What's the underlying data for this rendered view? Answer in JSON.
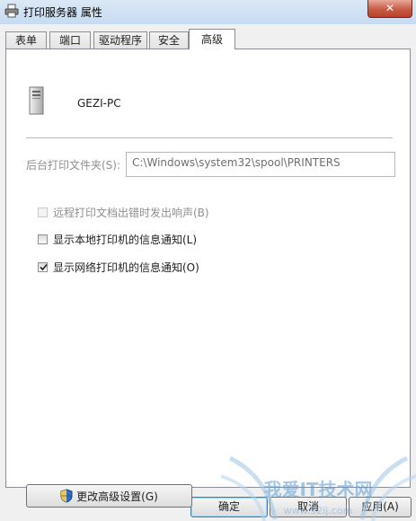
{
  "window": {
    "title": "打印服务器 属性",
    "close_label": "✕"
  },
  "tabs": [
    {
      "label": "表单"
    },
    {
      "label": "端口"
    },
    {
      "label": "驱动程序"
    },
    {
      "label": "安全"
    },
    {
      "label": "高级"
    }
  ],
  "active_tab": "高级",
  "server": {
    "name": "GEZI-PC",
    "icon": "computer-tower-icon"
  },
  "spool": {
    "label": "后台打印文件夹(S):",
    "value": "C:\\Windows\\system32\\spool\\PRINTERS"
  },
  "options": [
    {
      "label": "远程打印文档出错时发出响声(B)",
      "checked": false,
      "enabled": false
    },
    {
      "label": "显示本地打印机的信息通知(L)",
      "checked": false,
      "enabled": true
    },
    {
      "label": "显示网络打印机的信息通知(O)",
      "checked": true,
      "enabled": true
    }
  ],
  "advanced_button": {
    "label": "更改高级设置(G)",
    "icon": "uac-shield-icon"
  },
  "buttons": {
    "ok": "确定",
    "cancel": "取消",
    "apply": "应用(A)"
  },
  "watermark": {
    "text": "我爱IT技术网",
    "url": "www.52ij.com"
  }
}
